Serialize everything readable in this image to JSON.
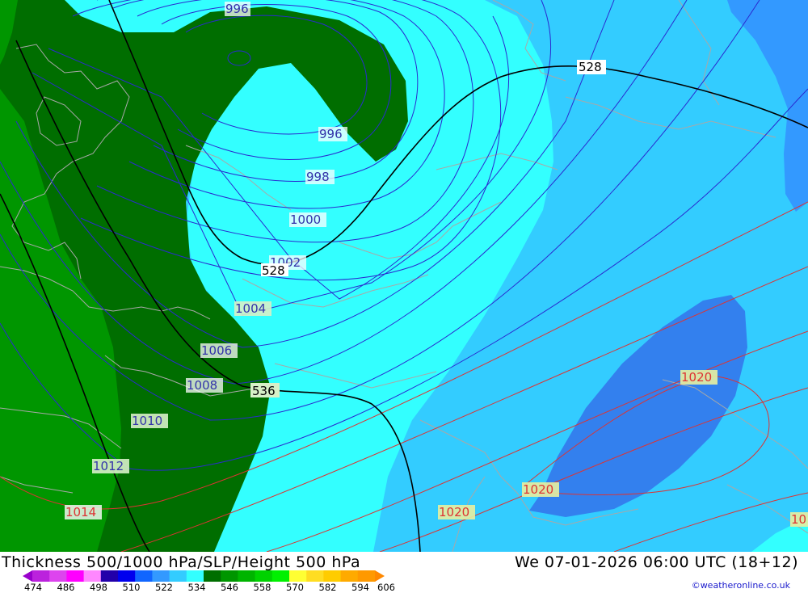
{
  "map": {
    "region": "Western Europe / British Isles",
    "fill_colors": {
      "very_dark_green": "#006e00",
      "dark_green": "#009600",
      "cyan": "#33ffff",
      "light_blue": "#33ccff",
      "blue": "#3399ff",
      "medium_blue": "#3380ee"
    },
    "isobar_color_low": "#2a2ad0",
    "isobar_color_high": "#dd3333",
    "height_contour_color": "#000000",
    "coastline_color": "#a8a8a8",
    "isobar_labels": [
      "996",
      "996",
      "998",
      "1000",
      "1002",
      "1004",
      "1006",
      "1008",
      "1010",
      "1012",
      "1014",
      "1020",
      "1020",
      "1020",
      "1020",
      "10"
    ],
    "height_labels": [
      "528",
      "528",
      "536"
    ]
  },
  "footer": {
    "title": "Thickness 500/1000 hPa/SLP/Height 500 hPa",
    "datetime": "We 07-01-2026 06:00 UTC (18+12)",
    "credit": "©weatheronline.co.uk",
    "scale_ticks": [
      "474",
      "486",
      "498",
      "510",
      "522",
      "534",
      "546",
      "558",
      "570",
      "582",
      "594",
      "606"
    ],
    "scale_colors": [
      "#9900cc",
      "#bb22dd",
      "#dd44ee",
      "#ff00ff",
      "#ff88ff",
      "#2200aa",
      "#0000ee",
      "#1166ff",
      "#3399ff",
      "#33ccff",
      "#33ffff",
      "#006e00",
      "#009600",
      "#00b400",
      "#00d200",
      "#00f000",
      "#ffff33",
      "#ffdd22",
      "#ffcc00",
      "#ffaa00",
      "#ff9900",
      "#ff8800"
    ]
  }
}
